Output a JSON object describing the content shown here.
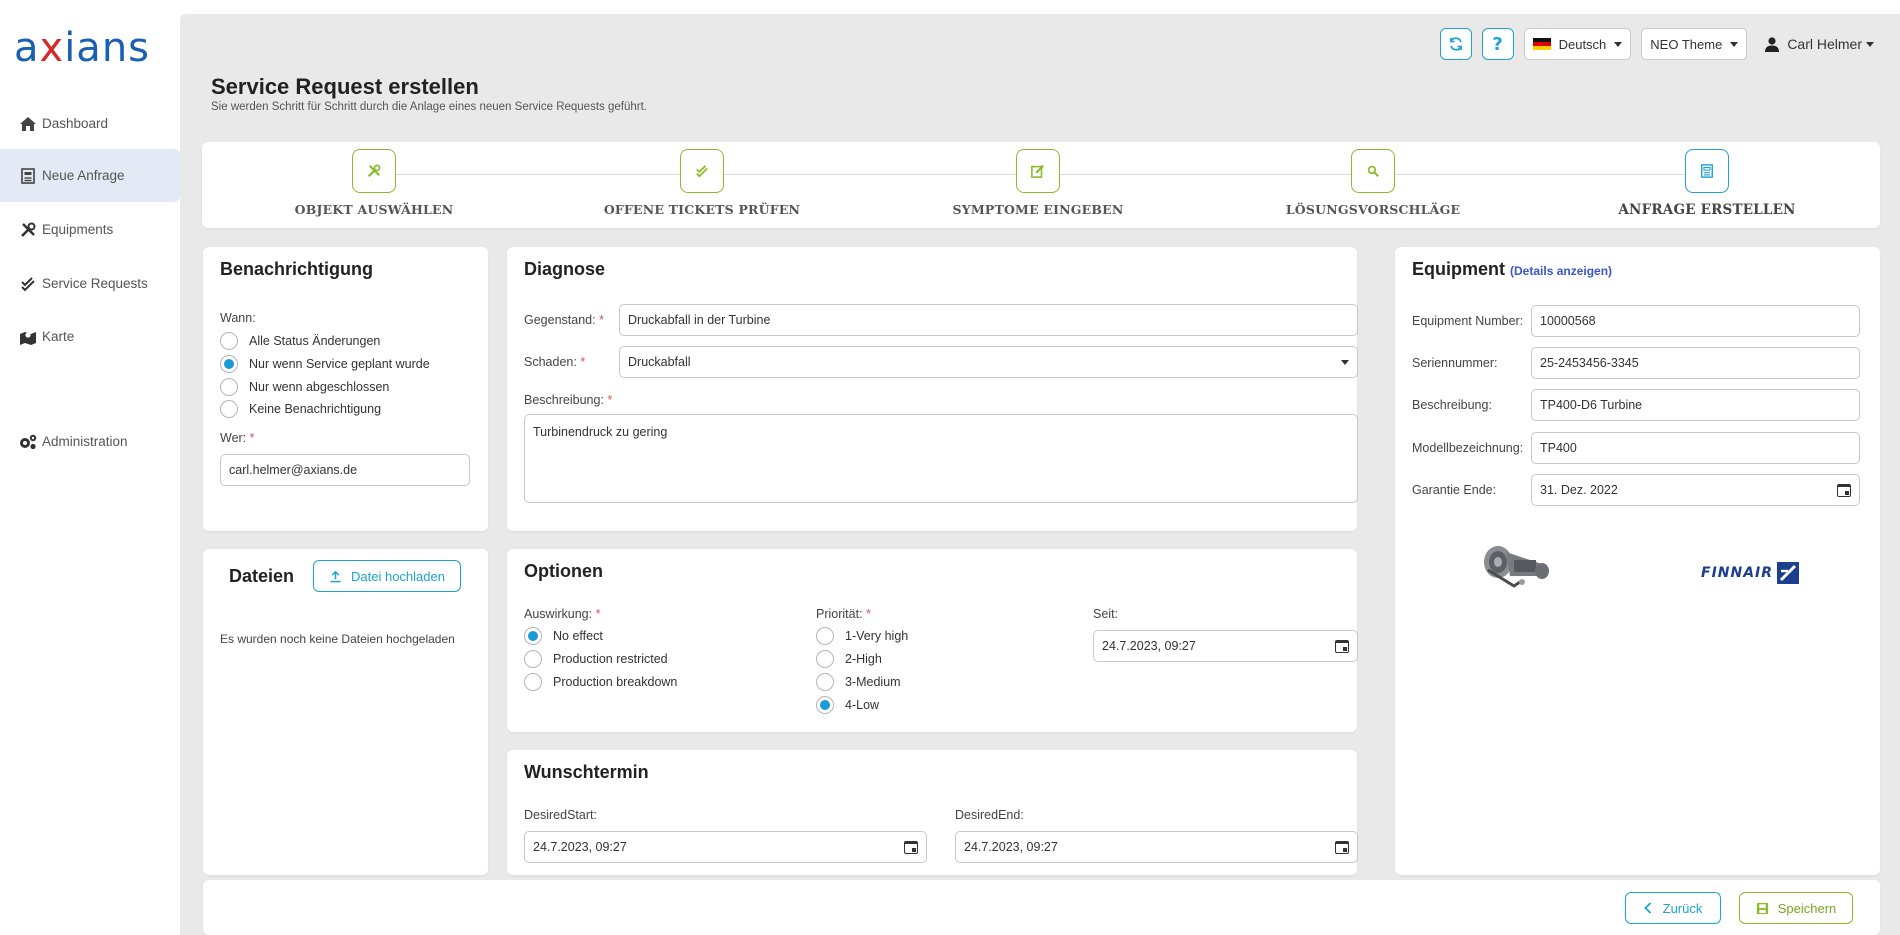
{
  "brand": {
    "logo_text_left": "a",
    "logo_text_x": "x",
    "logo_text_right": "ians",
    "logo_color": "#1a5fb4",
    "logo_accent": "#d62a2a"
  },
  "sidebar": {
    "items": [
      {
        "label": "Dashboard",
        "icon": "home-icon"
      },
      {
        "label": "Neue Anfrage",
        "icon": "form-icon",
        "active": true
      },
      {
        "label": "Equipments",
        "icon": "tools-icon"
      },
      {
        "label": "Service Requests",
        "icon": "double-check-icon"
      },
      {
        "label": "Karte",
        "icon": "map-icon"
      },
      {
        "label": "Administration",
        "icon": "gears-icon"
      }
    ]
  },
  "topbar": {
    "language": "Deutsch",
    "theme": "NEO Theme",
    "user": "Carl Helmer"
  },
  "page": {
    "title": "Service Request erstellen",
    "subtitle": "Sie werden Schritt für Schritt durch die Anlage eines neuen Service Requests geführt."
  },
  "steps": [
    {
      "label": "OBJEKT AUSWÄHLEN",
      "icon": "tools-icon"
    },
    {
      "label": "OFFENE TICKETS PRÜFEN",
      "icon": "double-check-icon"
    },
    {
      "label": "SYMPTOME EINGEBEN",
      "icon": "edit-icon"
    },
    {
      "label": "LÖSUNGSVORSCHLÄGE",
      "icon": "search-icon"
    },
    {
      "label": "ANFRAGE ERSTELLEN",
      "icon": "form-icon",
      "current": true
    }
  ],
  "notification": {
    "title": "Benachrichtigung",
    "when_label": "Wann:",
    "options": [
      "Alle Status Änderungen",
      "Nur wenn Service geplant wurde",
      "Nur wenn abgeschlossen",
      "Keine Benachrichtigung"
    ],
    "selected": 1,
    "who_label": "Wer:",
    "who_value": "carl.helmer@axians.de"
  },
  "files": {
    "title": "Dateien",
    "upload_label": "Datei hochladen",
    "empty_text": "Es wurden noch keine Dateien hochgeladen"
  },
  "diagnosis": {
    "title": "Diagnose",
    "subject_label": "Gegenstand:",
    "subject_value": "Druckabfall in der Turbine",
    "damage_label": "Schaden:",
    "damage_value": "Druckabfall",
    "description_label": "Beschreibung:",
    "description_value": "Turbinendruck zu gering"
  },
  "options": {
    "title": "Optionen",
    "impact_label": "Auswirkung:",
    "impact_options": [
      "No effect",
      "Production restricted",
      "Production breakdown"
    ],
    "impact_selected": 0,
    "priority_label": "Priorität:",
    "priority_options": [
      "1-Very high",
      "2-High",
      "3-Medium",
      "4-Low"
    ],
    "priority_selected": 3,
    "since_label": "Seit:",
    "since_value": "24.7.2023, 09:27"
  },
  "desired": {
    "title": "Wunschtermin",
    "start_label": "DesiredStart:",
    "start_value": "24.7.2023, 09:27",
    "end_label": "DesiredEnd:",
    "end_value": "24.7.2023, 09:27"
  },
  "equipment": {
    "title": "Equipment",
    "details_link": "(Details anzeigen)",
    "fields": [
      {
        "label": "Equipment Number:",
        "value": "10000568"
      },
      {
        "label": "Seriennummer:",
        "value": "25-2453456-3345"
      },
      {
        "label": "Beschreibung:",
        "value": "TP400-D6 Turbine"
      },
      {
        "label": "Modellbezeichnung:",
        "value": "TP400"
      },
      {
        "label": "Garantie Ende:",
        "value": "31. Dez. 2022"
      }
    ],
    "customer_logo_text": "FINNAIR"
  },
  "footer": {
    "back_label": "Zurück",
    "save_label": "Speichern"
  },
  "colors": {
    "accent_green": "#8bbb2a",
    "accent_blue": "#1fa3cf",
    "radio_blue": "#1a9ad6",
    "required_red": "#d9534f"
  }
}
